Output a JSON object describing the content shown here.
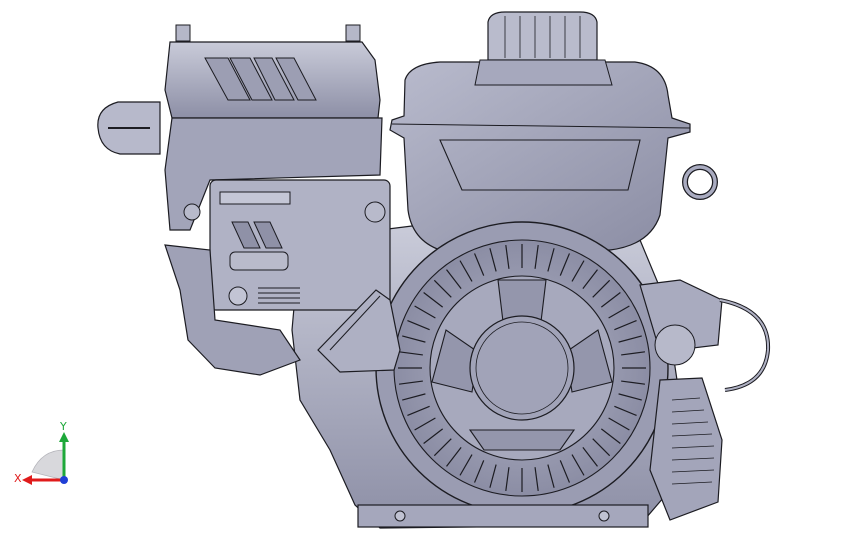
{
  "viewport": {
    "background": "#ffffff",
    "model_fill": "#a9abc0",
    "model_stroke": "#1c1c22"
  },
  "triad": {
    "x_label": "X",
    "y_label": "Y",
    "x_color": "#e01b1b",
    "y_color": "#1ea83a",
    "z_color": "#1f3fd6"
  }
}
